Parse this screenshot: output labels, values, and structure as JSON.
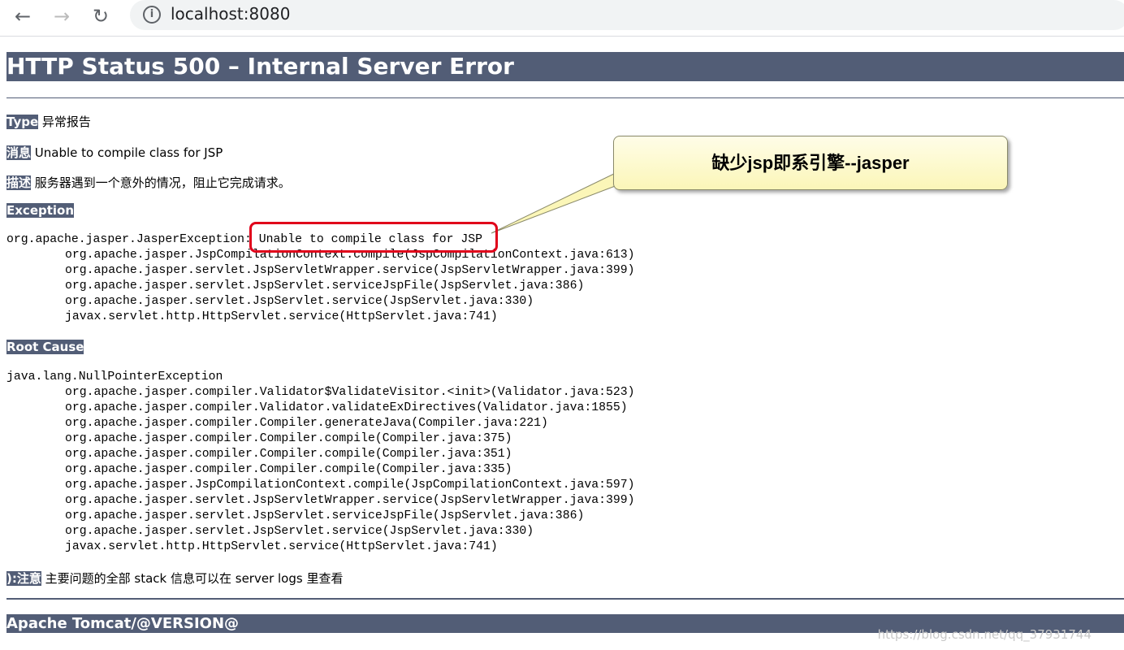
{
  "browser": {
    "url": "localhost:8080",
    "back_icon": "arrow-left-icon",
    "forward_icon": "arrow-right-icon",
    "reload_icon": "reload-icon",
    "info_icon": "info-icon"
  },
  "title": "HTTP Status 500 – Internal Server Error",
  "type": {
    "label": "Type",
    "value": "异常报告"
  },
  "message": {
    "label": "消息",
    "value": "Unable to compile class for JSP"
  },
  "description": {
    "label": "描述",
    "value": "服务器遇到一个意外的情况，阻止它完成请求。"
  },
  "exception": {
    "label": "Exception",
    "first": "org.apache.jasper.JasperException: Unable to compile class for JSP",
    "lines": [
      "org.apache.jasper.JspCompilationContext.compile(JspCompilationContext.java:613)",
      "org.apache.jasper.servlet.JspServletWrapper.service(JspServletWrapper.java:399)",
      "org.apache.jasper.servlet.JspServlet.serviceJspFile(JspServlet.java:386)",
      "org.apache.jasper.servlet.JspServlet.service(JspServlet.java:330)",
      "javax.servlet.http.HttpServlet.service(HttpServlet.java:741)"
    ]
  },
  "root_cause": {
    "label": "Root Cause",
    "first": "java.lang.NullPointerException",
    "lines": [
      "org.apache.jasper.compiler.Validator$ValidateVisitor.<init>(Validator.java:523)",
      "org.apache.jasper.compiler.Validator.validateExDirectives(Validator.java:1855)",
      "org.apache.jasper.compiler.Compiler.generateJava(Compiler.java:221)",
      "org.apache.jasper.compiler.Compiler.compile(Compiler.java:375)",
      "org.apache.jasper.compiler.Compiler.compile(Compiler.java:351)",
      "org.apache.jasper.compiler.Compiler.compile(Compiler.java:335)",
      "org.apache.jasper.JspCompilationContext.compile(JspCompilationContext.java:597)",
      "org.apache.jasper.servlet.JspServletWrapper.service(JspServletWrapper.java:399)",
      "org.apache.jasper.servlet.JspServlet.serviceJspFile(JspServlet.java:386)",
      "org.apache.jasper.servlet.JspServlet.service(JspServlet.java:330)",
      "javax.servlet.http.HttpServlet.service(HttpServlet.java:741)"
    ]
  },
  "note": {
    "label": "):注意",
    "value": "主要问题的全部 stack 信息可以在 server logs 里查看"
  },
  "footer": "Apache Tomcat/@VERSION@",
  "callout": "缺少jsp即系引擎--jasper",
  "watermark": "https://blog.csdn.net/qq_37931744",
  "colors": {
    "header": "#525D76",
    "highlight": "#e0001a",
    "callout_bg": "#fbf6b8"
  }
}
